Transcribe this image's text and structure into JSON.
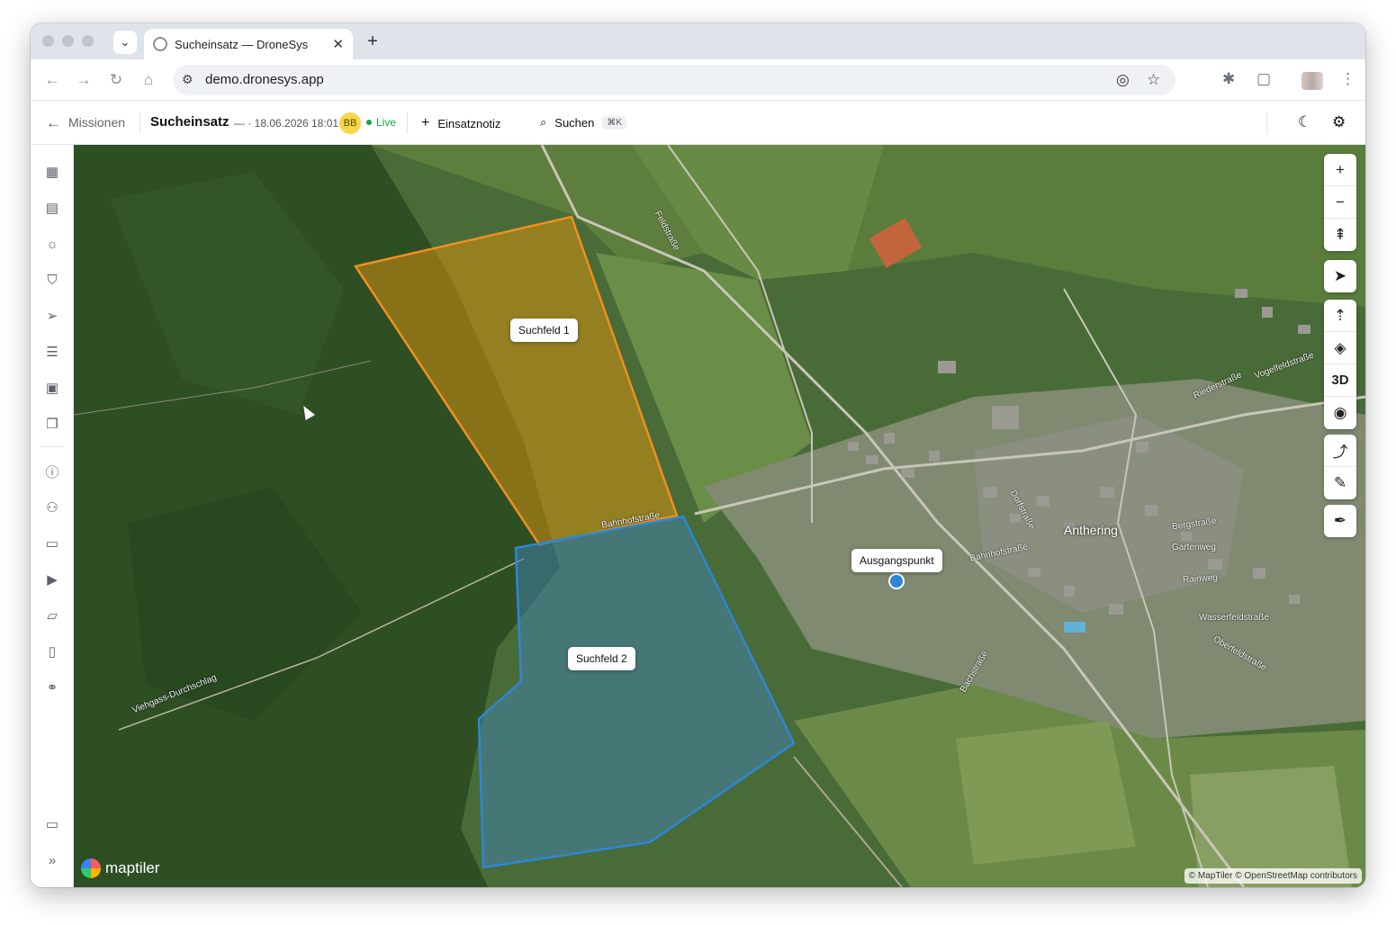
{
  "browser": {
    "tab_title": "Sucheinsatz — DroneSys",
    "url": "demo.dronesys.app",
    "tab_dropdown_icon": "chevron-down-icon",
    "new_tab_icon": "plus-icon"
  },
  "header": {
    "back_label": "Missionen",
    "mission_title": "Sucheinsatz",
    "date": "— · 18.06.2026 18:01",
    "avatar_initials": "BB",
    "status": "Live",
    "note_button": "Einsatznotiz",
    "search_button": "Suchen",
    "search_shortcut": "⌘K",
    "colors": {
      "live": "#14a34a",
      "avatar": "#f6d64a"
    }
  },
  "sidebar": {
    "items": [
      {
        "icon": "map-icon"
      },
      {
        "icon": "radio-icon"
      },
      {
        "icon": "weather-icon"
      },
      {
        "icon": "shield-icon"
      },
      {
        "icon": "send-icon"
      },
      {
        "icon": "list-icon"
      },
      {
        "icon": "image-icon"
      },
      {
        "icon": "copy-icon"
      },
      {
        "icon": "info-icon"
      },
      {
        "icon": "users-icon"
      },
      {
        "icon": "id-card-icon"
      },
      {
        "icon": "video-icon"
      },
      {
        "icon": "folder-icon"
      },
      {
        "icon": "document-icon"
      },
      {
        "icon": "link-icon"
      },
      {
        "icon": "monitor-icon"
      },
      {
        "icon": "expand-icon"
      }
    ]
  },
  "map": {
    "labels": {
      "field1": "Suchfeld 1",
      "field2": "Suchfeld 2",
      "start": "Ausgangspunkt"
    },
    "town": "Anthering",
    "streets": {
      "feldstrasse": "Feldstraße",
      "bahnhofstrasse": "Bahnhofstraße",
      "bahnhofstrasse2": "Bahnhofstraße",
      "viehgass": "Viehgass-Durchschlag",
      "dorfstrasse": "Dorfstraße",
      "bergstrasse": "Bergstraße",
      "gartenweg": "Gartenweg",
      "rainweg": "Rainweg",
      "wasserfeldstrasse": "Wasserfeldstraße",
      "oberfeldstrasse": "Oberfeldstraße",
      "bachstrasse": "Bachstraße",
      "vogelfeldstrasse": "Vogelfeldstraße",
      "riederstrasse": "Riederstraße"
    },
    "colors": {
      "field1": "#f0901e",
      "field2": "#2f86d6",
      "start_point": "#2f86d6"
    },
    "controls": {
      "three_d": "3D"
    },
    "logo_text": "maptiler",
    "attribution": "© MapTiler © OpenStreetMap contributors"
  }
}
